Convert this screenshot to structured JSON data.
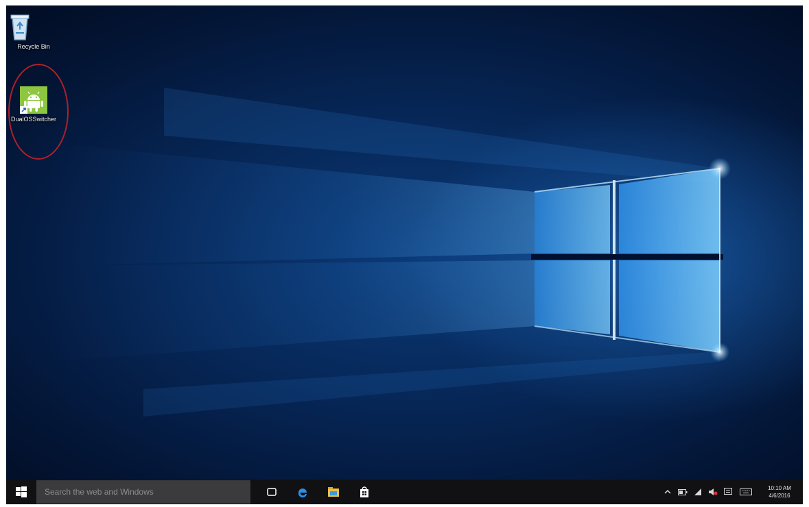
{
  "desktop": {
    "icons": [
      {
        "label": "Recycle Bin",
        "icon": "recycle-bin-icon"
      },
      {
        "label": "DualOSSwitcher",
        "icon": "android-icon"
      }
    ]
  },
  "taskbar": {
    "search_placeholder": "Search the web and Windows",
    "pinned": [
      "task-view-icon",
      "edge-icon",
      "file-explorer-icon",
      "store-icon"
    ],
    "tray": [
      "chevron-up-icon",
      "battery-icon",
      "network-icon",
      "volume-muted-icon",
      "action-center-icon",
      "keyboard-icon"
    ],
    "clock": {
      "time": "10:10 AM",
      "date": "4/6/2016"
    }
  },
  "colors": {
    "highlight_circle": "#b0202a",
    "android_green": "#8dc63f",
    "taskbar": "#111113"
  }
}
